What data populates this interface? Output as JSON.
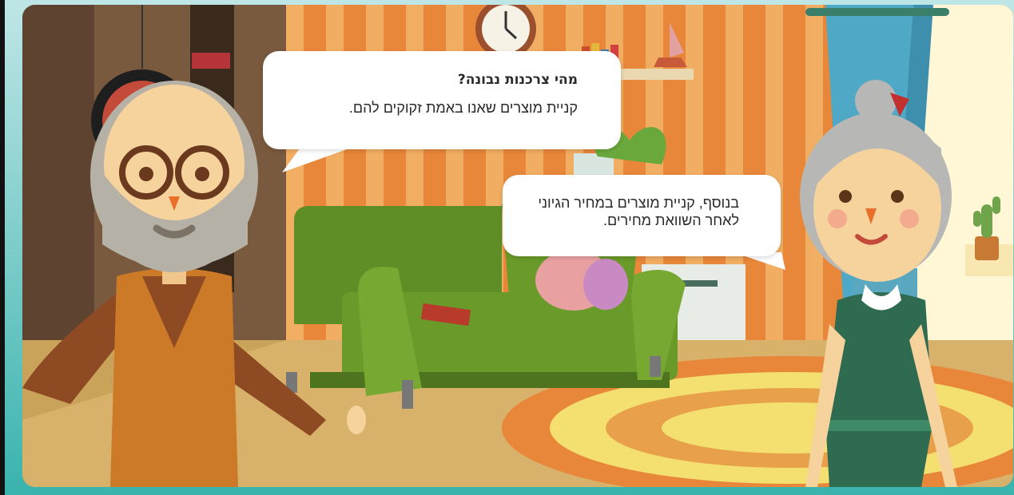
{
  "dialog": {
    "grandpa_bubble": {
      "title": "מהי צרכנות נבונה?",
      "text": "קניית מוצרים שאנו באמת זקוקים להם."
    },
    "grandma_bubble": {
      "text": "בנוסף, קניית מוצרים במחיר הגיוני לאחר השוואת מחירים."
    }
  },
  "colors": {
    "frame_gradient_top": "#bfe6e6",
    "frame_gradient_bottom": "#3ab3ad",
    "wall_orange": "#e8873a",
    "wall_stripe": "#f3b56a",
    "sofa_green": "#6a9a2a",
    "rug_yellow": "#f3e070",
    "curtain_blue": "#4fa9c6"
  }
}
